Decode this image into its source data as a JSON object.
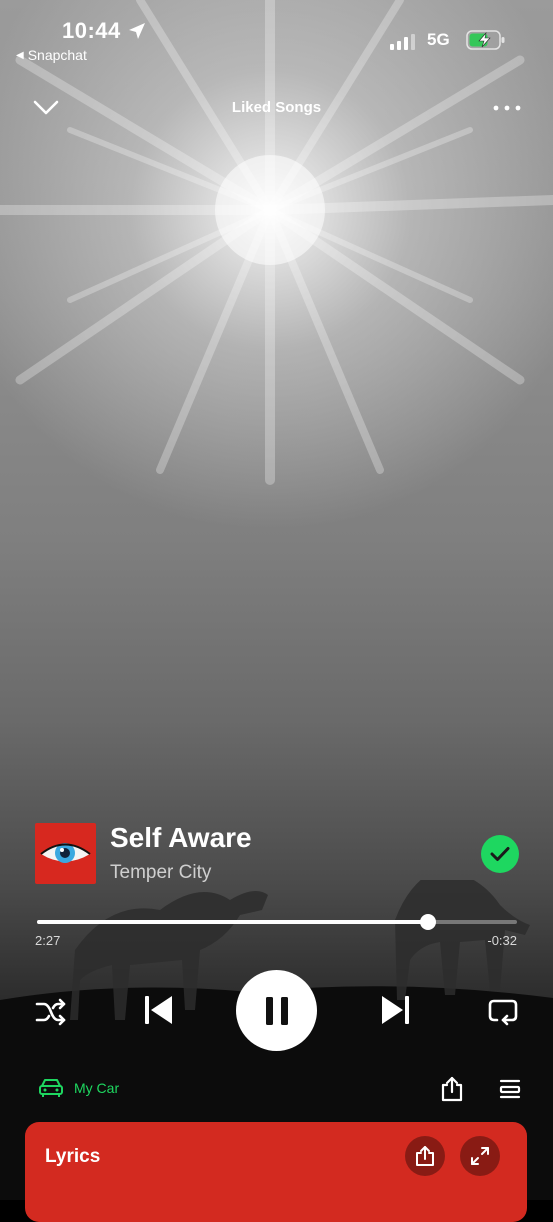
{
  "status": {
    "time": "10:44",
    "back_app": "Snapchat",
    "network": "5G"
  },
  "header": {
    "playlist_title": "Liked Songs"
  },
  "track": {
    "title": "Self Aware",
    "artist": "Temper City",
    "elapsed": "2:27",
    "remaining": "-0:32",
    "progress": 0.815,
    "liked": true
  },
  "device": {
    "label": "My Car"
  },
  "lyrics": {
    "title": "Lyrics"
  },
  "colors": {
    "accent_green": "#1ed760",
    "lyrics_card": "#d32a20",
    "artwork": "#d7281f"
  },
  "icons": [
    "location-arrow-icon",
    "signal-icon",
    "battery-charging-icon",
    "chevron-down-icon",
    "more-icon",
    "check-icon",
    "shuffle-icon",
    "previous-icon",
    "pause-icon",
    "next-icon",
    "repeat-icon",
    "car-icon",
    "share-icon",
    "queue-icon",
    "expand-icon"
  ]
}
